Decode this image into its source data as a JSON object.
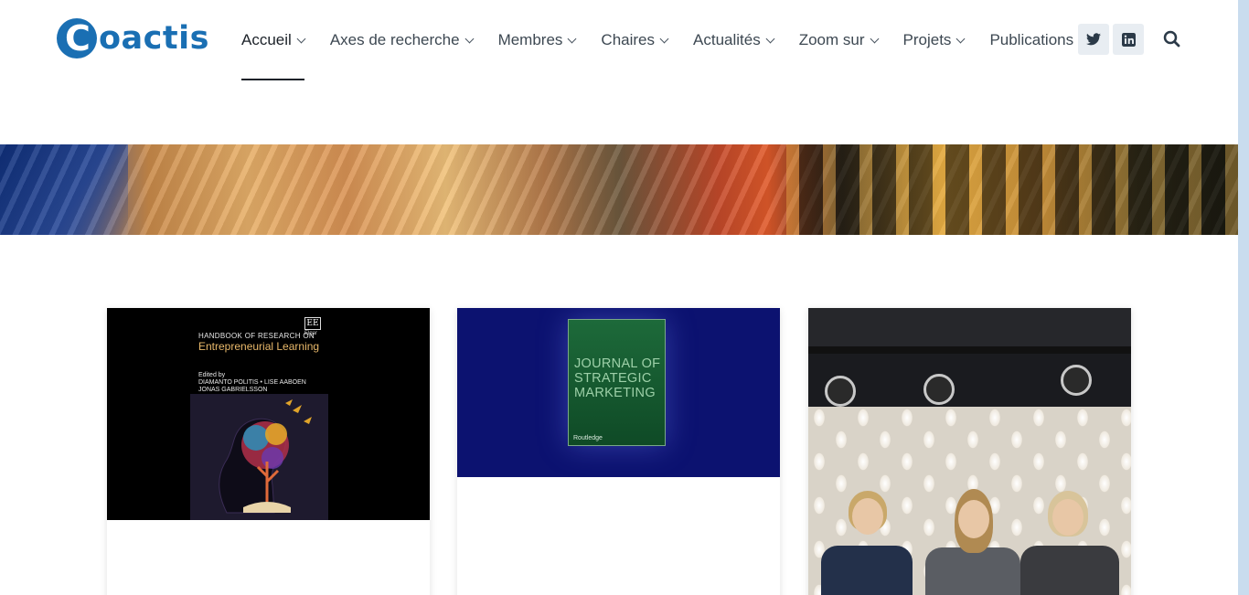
{
  "logo": {
    "text": "Coactis",
    "brand_color": "#1a6fb3"
  },
  "nav": {
    "items": [
      {
        "label": "Accueil",
        "active": true
      },
      {
        "label": "Axes de recherche",
        "active": false
      },
      {
        "label": "Membres",
        "active": false
      },
      {
        "label": "Chaires",
        "active": false
      },
      {
        "label": "Actualités",
        "active": false
      },
      {
        "label": "Zoom sur",
        "active": false
      },
      {
        "label": "Projets",
        "active": false
      },
      {
        "label": "Publications",
        "active": false
      }
    ]
  },
  "social": [
    {
      "icon": "twitter-icon"
    },
    {
      "icon": "linkedin-icon"
    }
  ],
  "search": {
    "icon": "search-icon"
  },
  "cards": [
    {
      "book": {
        "series": "HANDBOOK OF RESEARCH ON",
        "title": "Entrepreneurial Learning",
        "publisher_mark": "EE",
        "publisher_name": "Elgar",
        "edited_by": "Edited by",
        "editors_line1": "DIAMANTO POLITIS • LISE AABOEN",
        "editors_line2": "JONAS GABRIELSSON"
      }
    },
    {
      "journal": {
        "title_line1": "JOURNAL OF",
        "title_line2": "STRATEGIC",
        "title_line3": "MARKETING",
        "publisher": "Routledge"
      }
    },
    {
      "photo": {
        "subject": "three-people-photo"
      }
    }
  ]
}
